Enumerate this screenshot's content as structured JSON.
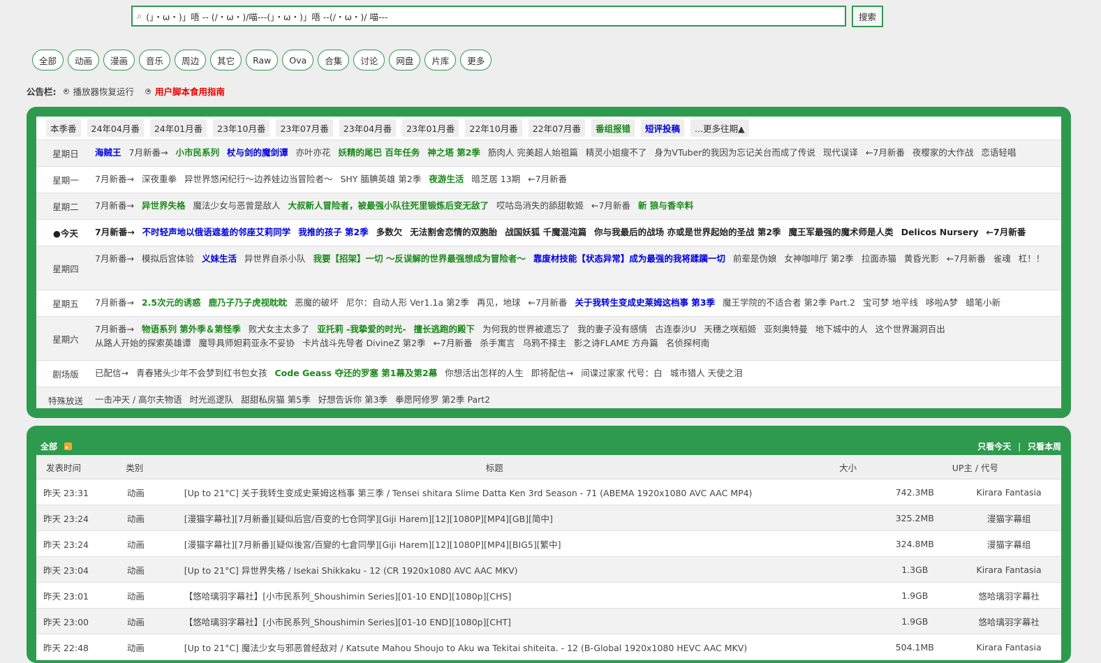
{
  "search": {
    "value": "(」・ω・)」唔 -- (/・ω・)/喵---(」・ω・)」唔 --(/・ω・)/ 喵---",
    "button": "搜索"
  },
  "categories": [
    "全部",
    "动画",
    "漫画",
    "音乐",
    "周边",
    "其它",
    "Raw",
    "Ova",
    "合集",
    "讨论",
    "网盘",
    "片库",
    "更多"
  ],
  "notice": {
    "label": "公告栏:",
    "items": [
      {
        "text": "播放器恢复运行",
        "style": "normal"
      },
      {
        "text": "用户脚本食用指南",
        "style": "red"
      }
    ]
  },
  "schedule": {
    "seasons": [
      {
        "text": "本季番",
        "style": "normal"
      },
      {
        "text": "24年04月番",
        "style": "normal"
      },
      {
        "text": "24年01月番",
        "style": "normal"
      },
      {
        "text": "23年10月番",
        "style": "normal"
      },
      {
        "text": "23年07月番",
        "style": "normal"
      },
      {
        "text": "23年04月番",
        "style": "normal"
      },
      {
        "text": "23年01月番",
        "style": "normal"
      },
      {
        "text": "22年10月番",
        "style": "normal"
      },
      {
        "text": "22年07月番",
        "style": "normal"
      },
      {
        "text": "番组报错",
        "style": "green"
      },
      {
        "text": "短评投稿",
        "style": "blue"
      },
      {
        "text": "...更多往期▲",
        "style": "normal"
      }
    ],
    "days": [
      {
        "label": "星期日",
        "today": false,
        "items": [
          {
            "t": "海贼王",
            "s": "blue"
          },
          {
            "t": "7月新番→",
            "s": "norm"
          },
          {
            "t": "小市民系列",
            "s": "green"
          },
          {
            "t": "杖与剑的魔剑谭",
            "s": "blue"
          },
          {
            "t": "亦叶亦花",
            "s": "norm"
          },
          {
            "t": "妖精的尾巴 百年任务",
            "s": "green"
          },
          {
            "t": "神之塔 第2季",
            "s": "green"
          },
          {
            "t": "筋肉人 完美超人始祖篇",
            "s": "norm"
          },
          {
            "t": "精灵小姐瘦不了",
            "s": "norm"
          },
          {
            "t": "身为VTuber的我因为忘记关台而成了传说",
            "s": "norm"
          },
          {
            "t": "现代误译",
            "s": "norm"
          },
          {
            "t": "←7月新番",
            "s": "norm"
          },
          {
            "t": "夜樱家的大作战",
            "s": "norm"
          },
          {
            "t": "恋语轻唱",
            "s": "norm"
          }
        ]
      },
      {
        "label": "星期一",
        "today": false,
        "items": [
          {
            "t": "7月新番→",
            "s": "norm"
          },
          {
            "t": "深夜重拳",
            "s": "norm"
          },
          {
            "t": "异世界悠闲纪行～边养娃边当冒险者～",
            "s": "norm"
          },
          {
            "t": "SHY 腼腆英雄 第2季",
            "s": "norm"
          },
          {
            "t": "夜游生活",
            "s": "green"
          },
          {
            "t": "暗芝居 13期",
            "s": "norm"
          },
          {
            "t": "←7月新番",
            "s": "norm"
          }
        ]
      },
      {
        "label": "星期二",
        "today": false,
        "items": [
          {
            "t": "7月新番→",
            "s": "norm"
          },
          {
            "t": "异世界失格",
            "s": "green"
          },
          {
            "t": "魔法少女与恶曾是敌人",
            "s": "norm"
          },
          {
            "t": "大叔新人冒险者，被最强小队往死里锻炼后变无敌了",
            "s": "green"
          },
          {
            "t": "哎咕岛消失的舔甜軟姬",
            "s": "norm"
          },
          {
            "t": "←7月新番",
            "s": "norm"
          },
          {
            "t": "新 狼与香辛料",
            "s": "green"
          }
        ]
      },
      {
        "label": "●今天",
        "today": true,
        "items": [
          {
            "t": "7月新番→",
            "s": "dark"
          },
          {
            "t": "不时轻声地以俄语遮羞的邻座艾莉同学",
            "s": "blue"
          },
          {
            "t": "我推的孩子 第2季",
            "s": "blue"
          },
          {
            "t": "多数欠",
            "s": "dark"
          },
          {
            "t": "无法割舍恋情的双胞胎",
            "s": "dark"
          },
          {
            "t": "战国妖狐 千魔混沌篇",
            "s": "dark"
          },
          {
            "t": "你与我最后的战场 亦或是世界起始的圣战 第2季",
            "s": "dark"
          },
          {
            "t": "魔王军最强的魔术师是人类",
            "s": "dark"
          },
          {
            "t": "Delicos Nursery",
            "s": "dark"
          },
          {
            "t": "←7月新番",
            "s": "dark"
          }
        ]
      },
      {
        "label": "星期四",
        "today": false,
        "items": [
          {
            "t": "7月新番→",
            "s": "norm"
          },
          {
            "t": "模拟后宫体验",
            "s": "norm"
          },
          {
            "t": "义妹生活",
            "s": "blue"
          },
          {
            "t": "异世界自杀小队",
            "s": "norm"
          },
          {
            "t": "我要【招架】一切 ～反误解的世界最强想成为冒险者～",
            "s": "green"
          },
          {
            "t": "靠废材技能【状态异常】成为最强的我将蹂躏一切",
            "s": "blue"
          },
          {
            "t": "前辈是伪娘",
            "s": "norm"
          },
          {
            "t": "女神咖啡厅 第2季",
            "s": "norm"
          },
          {
            "t": "拉面赤猫",
            "s": "norm"
          },
          {
            "t": "黄昏光影",
            "s": "norm"
          },
          {
            "t": "←7月新番",
            "s": "norm"
          },
          {
            "t": "雀魂",
            "s": "norm"
          },
          {
            "t": "杠！！",
            "s": "norm"
          }
        ]
      },
      {
        "label": "星期五",
        "today": false,
        "items": [
          {
            "t": "7月新番→",
            "s": "norm"
          },
          {
            "t": "2.5次元的诱惑",
            "s": "green"
          },
          {
            "t": "鹿乃子乃子虎视眈眈",
            "s": "green"
          },
          {
            "t": "恶魔的破坏",
            "s": "norm"
          },
          {
            "t": "尼尔：自动人形 Ver1.1a 第2季",
            "s": "norm"
          },
          {
            "t": "再见，地球",
            "s": "norm"
          },
          {
            "t": "←7月新番",
            "s": "norm"
          },
          {
            "t": "关于我转生变成史莱姆这档事 第3季",
            "s": "blue"
          },
          {
            "t": "魔王学院的不适合者 第2季 Part.2",
            "s": "norm"
          },
          {
            "t": "宝可梦 地平线",
            "s": "norm"
          },
          {
            "t": "哆啦A梦",
            "s": "norm"
          },
          {
            "t": "蜡笔小新",
            "s": "norm"
          }
        ]
      },
      {
        "label": "星期六",
        "today": false,
        "items": [
          {
            "t": "7月新番→",
            "s": "norm"
          },
          {
            "t": "物语系列 第外季＆第怪季",
            "s": "green"
          },
          {
            "t": "败犬女主太多了",
            "s": "norm"
          },
          {
            "t": "亚托莉 -我挚爱的时光-",
            "s": "green"
          },
          {
            "t": "擅长逃跑的殿下",
            "s": "green"
          },
          {
            "t": "为何我的世界被遗忘了",
            "s": "norm"
          },
          {
            "t": "我的妻子没有感情",
            "s": "norm"
          },
          {
            "t": "古连泰沙U",
            "s": "norm"
          },
          {
            "t": "天穗之咲稻姬",
            "s": "norm"
          },
          {
            "t": "亚刻奥特曼",
            "s": "norm"
          },
          {
            "t": "地下城中的人",
            "s": "norm"
          },
          {
            "t": "这个世界漏洞百出",
            "s": "norm"
          },
          {
            "t": "从路人开始的探索英雄谭",
            "s": "norm"
          },
          {
            "t": "魔导具师妲莉亚永不妥协",
            "s": "norm"
          },
          {
            "t": "卡片战斗先导者 DivineZ 第2季",
            "s": "norm"
          },
          {
            "t": "←7月新番",
            "s": "norm"
          },
          {
            "t": "杀手寓言",
            "s": "norm"
          },
          {
            "t": "乌鸦不择主",
            "s": "norm"
          },
          {
            "t": "影之诗FLAME 方舟篇",
            "s": "norm"
          },
          {
            "t": "名侦探柯南",
            "s": "norm"
          }
        ]
      },
      {
        "label": "剧场版",
        "today": false,
        "items": [
          {
            "t": "已配信→",
            "s": "norm"
          },
          {
            "t": "青春猪头少年不会梦到红书包女孩",
            "s": "norm"
          },
          {
            "t": "Code Geass 夺还的罗塞 第1幕及第2幕",
            "s": "green"
          },
          {
            "t": "你想活出怎样的人生",
            "s": "norm"
          },
          {
            "t": "即将配信→",
            "s": "norm"
          },
          {
            "t": "间谍过家家 代号：白",
            "s": "norm"
          },
          {
            "t": "城市猎人 天使之泪",
            "s": "norm"
          }
        ]
      },
      {
        "label": "特殊放送",
        "today": false,
        "items": [
          {
            "t": "一击冲天 / 高尔夫物语",
            "s": "norm"
          },
          {
            "t": "时光巡逻队",
            "s": "norm"
          },
          {
            "t": "甜甜私房猫 第5季",
            "s": "norm"
          },
          {
            "t": "好想告诉你 第3季",
            "s": "norm"
          },
          {
            "t": "拳愿阿修罗 第2季 Part2",
            "s": "norm"
          }
        ]
      }
    ]
  },
  "list": {
    "title": "全部",
    "filter_today": "只看今天",
    "separator": "|",
    "filter_week": "只看本周",
    "headers": {
      "time": "发表时间",
      "category": "类别",
      "title": "标题",
      "size": "大小",
      "uploader": "UP主 / 代号"
    },
    "rows": [
      {
        "time": "昨天 23:31",
        "category": "动画",
        "title": "[Up to 21°C] 关于我转生变成史莱姆这档事 第三季 / Tensei shitara Slime Datta Ken 3rd Season - 71 (ABEMA 1920x1080 AVC AAC MP4)",
        "size": "742.3MB",
        "uploader": "Kirara Fantasia"
      },
      {
        "time": "昨天 23:24",
        "category": "动画",
        "title": "[漫猫字幕社][7月新番][疑似后宫/百变的七仓同学][Giji Harem][12][1080P][MP4][GB][简中]",
        "size": "325.2MB",
        "uploader": "漫猫字幕组"
      },
      {
        "time": "昨天 23:24",
        "category": "动画",
        "title": "[漫猫字幕社][7月新番][疑似後宮/百變的七倉同學][Giji Harem][12][1080P][MP4][BIG5][繁中]",
        "size": "324.8MB",
        "uploader": "漫猫字幕组"
      },
      {
        "time": "昨天 23:04",
        "category": "动画",
        "title": "[Up to 21°C] 异世界失格 / Isekai Shikkaku - 12 (CR 1920x1080 AVC AAC MKV)",
        "size": "1.3GB",
        "uploader": "Kirara Fantasia"
      },
      {
        "time": "昨天 23:01",
        "category": "动画",
        "title": "【悠哈璃羽字幕社】[小市民系列_Shoushimin Series][01-10 END][1080p][CHS]",
        "size": "1.9GB",
        "uploader": "悠哈璃羽字幕社"
      },
      {
        "time": "昨天 23:00",
        "category": "动画",
        "title": "【悠哈璃羽字幕社】[小市民系列_Shoushimin Series][01-10 END][1080p][CHT]",
        "size": "1.9GB",
        "uploader": "悠哈璃羽字幕社"
      },
      {
        "time": "昨天 22:48",
        "category": "动画",
        "title": "[Up to 21°C] 魔法少女与邪恶曾经敌对 / Katsute Mahou Shoujo to Aku wa Tekitai shiteita. - 12 (B-Global 1920x1080 HEVC AAC MKV)",
        "size": "504.1MB",
        "uploader": "Kirara Fantasia"
      }
    ]
  }
}
